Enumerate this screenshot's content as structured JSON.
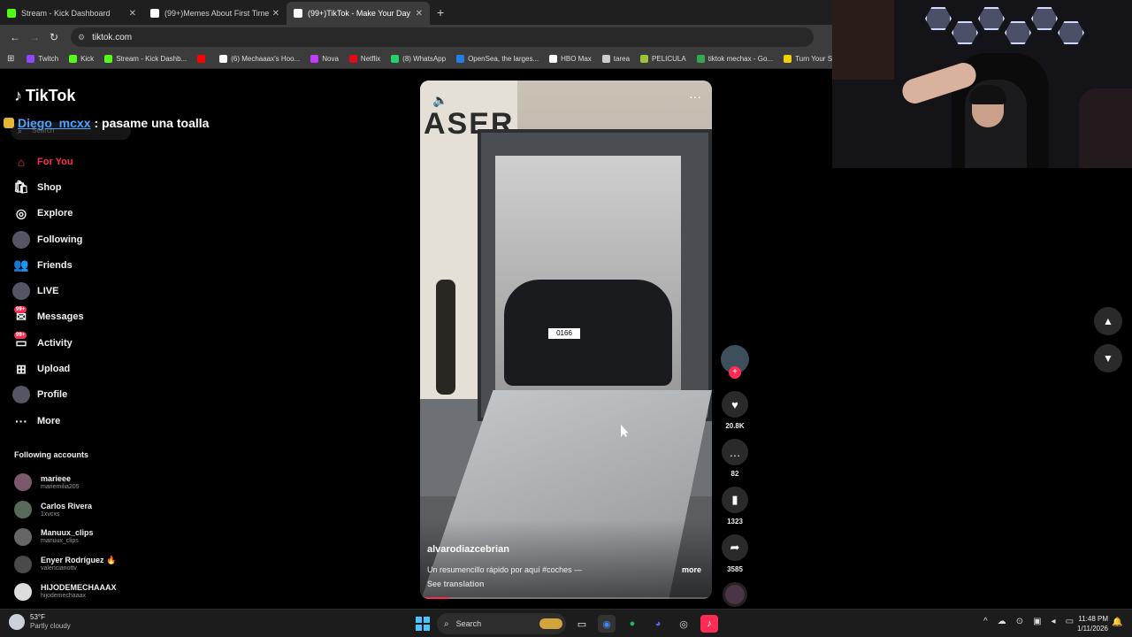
{
  "browser": {
    "tabs": [
      {
        "label": "Stream - Kick Dashboard",
        "color": "#53fc18"
      },
      {
        "label": "(99+)Memes About First Time I",
        "color": "#ffffff"
      },
      {
        "label": "(99+)TikTok - Make Your Day",
        "color": "#ffffff"
      }
    ],
    "url": "tiktok.com",
    "bookmarks": [
      {
        "label": "Twitch",
        "color": "#9146ff"
      },
      {
        "label": "Kick",
        "color": "#53fc18"
      },
      {
        "label": "Stream - Kick Dashb...",
        "color": "#53fc18"
      },
      {
        "label": "",
        "color": "#ff0000"
      },
      {
        "label": "(6) Mechaaax's Hoo...",
        "color": "#ffffff"
      },
      {
        "label": "Nova",
        "color": "#c03cff"
      },
      {
        "label": "Netflix",
        "color": "#e50914"
      },
      {
        "label": "(8) WhatsApp",
        "color": "#25d366"
      },
      {
        "label": "OpenSea, the larges...",
        "color": "#2081e2"
      },
      {
        "label": "HBO Max",
        "color": "#ffffff"
      },
      {
        "label": "tarea",
        "color": "#cccccc"
      },
      {
        "label": "PELICULA",
        "color": "#9ac43a"
      },
      {
        "label": "tiktok mechax - Go...",
        "color": "#34a853"
      },
      {
        "label": "Turn Your S",
        "color": "#f5d000"
      }
    ]
  },
  "tiktok": {
    "brand": "TikTok",
    "search_placeholder": "Search",
    "chat": {
      "user": "Diego_mcxx",
      "message": ": pasame una toalla"
    },
    "nav": [
      {
        "label": "For You",
        "icon": "home-icon",
        "glyph": "⌂",
        "active": true
      },
      {
        "label": "Shop",
        "icon": "shop-icon",
        "glyph": "🛍",
        "active": false
      },
      {
        "label": "Explore",
        "icon": "compass-icon",
        "glyph": "◎",
        "active": false
      },
      {
        "label": "Following",
        "icon": "avatar",
        "glyph": "",
        "active": false
      },
      {
        "label": "Friends",
        "icon": "friends-icon",
        "glyph": "👥",
        "active": false
      },
      {
        "label": "LIVE",
        "icon": "avatar",
        "glyph": "",
        "active": false
      },
      {
        "label": "Messages",
        "icon": "messages-icon",
        "glyph": "✉",
        "active": false,
        "badge": "99+"
      },
      {
        "label": "Activity",
        "icon": "activity-icon",
        "glyph": "▭",
        "active": false,
        "badge": "99+"
      },
      {
        "label": "Upload",
        "icon": "upload-icon",
        "glyph": "⊞",
        "active": false
      },
      {
        "label": "Profile",
        "icon": "avatar",
        "glyph": "",
        "active": false
      },
      {
        "label": "More",
        "icon": "more-icon",
        "glyph": "···",
        "active": false
      }
    ],
    "following_title": "Following accounts",
    "following": [
      {
        "name": "marieee",
        "handle": "mariemilia205",
        "color": "#7a5a6a"
      },
      {
        "name": "Carlos Rivera",
        "handle": "1xvcxs",
        "color": "#5a6a5a"
      },
      {
        "name": "Manuux_clips",
        "handle": "manuux_clips",
        "color": "#666666"
      },
      {
        "name": "Enyer Rodríguez 🔥",
        "handle": "valencianottv",
        "color": "#4a4a4a"
      },
      {
        "name": "HIJODEMECHAAAX",
        "handle": "hijodemechaaax",
        "color": "#dddddd"
      }
    ],
    "video": {
      "storefront_text": "ASER",
      "plate": "0166",
      "author": "alvarodiazcebrian",
      "caption": "Un resumencillo rápido por aquí #coches —",
      "more": "more",
      "see_translation": "See translation",
      "progress": 0.1
    },
    "actions": {
      "likes": "20.8K",
      "comments": "82",
      "saves": "1323",
      "shares": "3585"
    }
  },
  "taskbar": {
    "temperature": "53°F",
    "weather": "Partly cloudy",
    "search": "Search",
    "time": "11:48 PM",
    "date": "1/11/2026"
  }
}
